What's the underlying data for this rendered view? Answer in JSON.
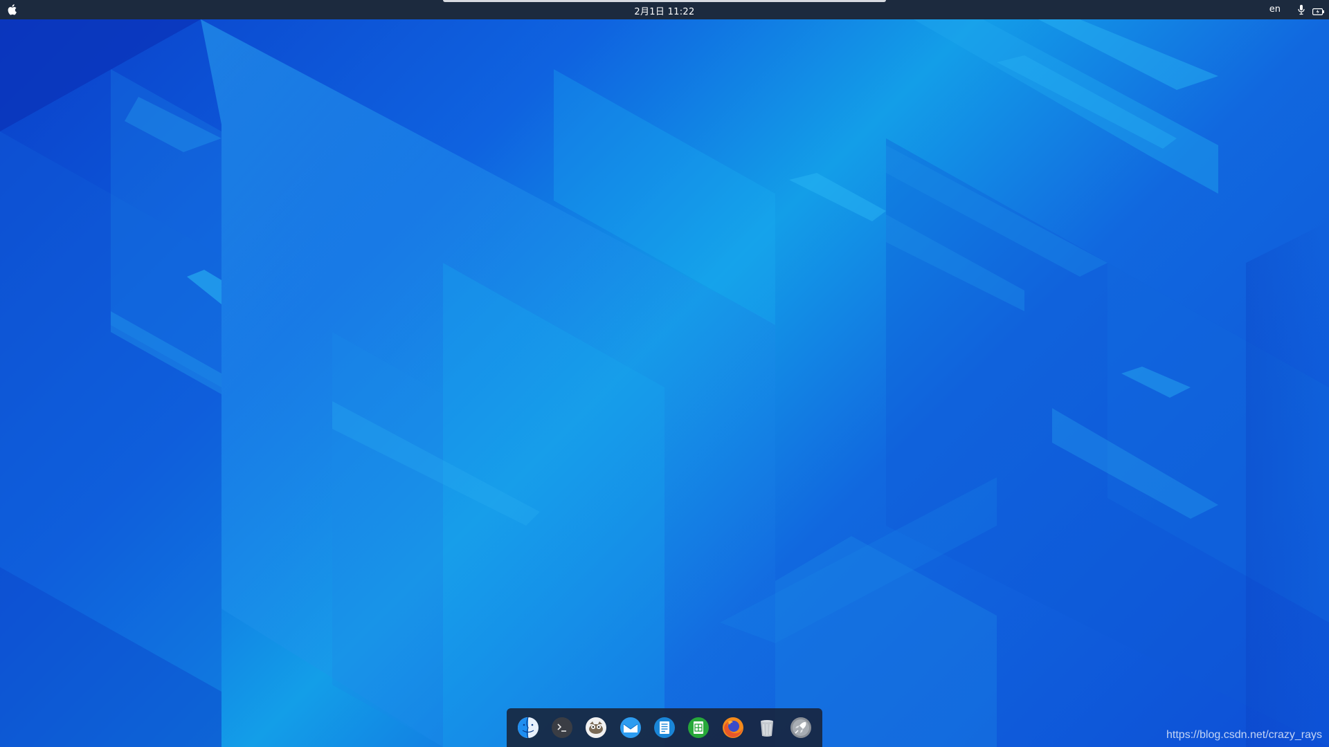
{
  "top_bar": {
    "apple_menu_icon": "apple-icon",
    "clock": "2月1日  11:22",
    "language": "en",
    "status_icons": [
      "microphone-icon",
      "battery-icon"
    ]
  },
  "dock": {
    "items": [
      {
        "name": "Finder",
        "icon": "finder-icon"
      },
      {
        "name": "Terminal",
        "icon": "terminal-icon"
      },
      {
        "name": "GIMP",
        "icon": "gimp-icon"
      },
      {
        "name": "Mail",
        "icon": "mail-icon"
      },
      {
        "name": "Document Writer",
        "icon": "writer-icon"
      },
      {
        "name": "Spreadsheet",
        "icon": "spreadsheet-icon"
      },
      {
        "name": "Firefox",
        "icon": "firefox-icon"
      },
      {
        "name": "Trash",
        "icon": "trash-icon"
      },
      {
        "name": "Launchpad",
        "icon": "launchpad-icon"
      }
    ]
  },
  "watermark": "https://blog.csdn.net/crazy_rays",
  "colors": {
    "top_bar_bg": "#1c2a3e",
    "wallpaper_dark": "#0a3fc9",
    "wallpaper_light": "#139ee8"
  }
}
